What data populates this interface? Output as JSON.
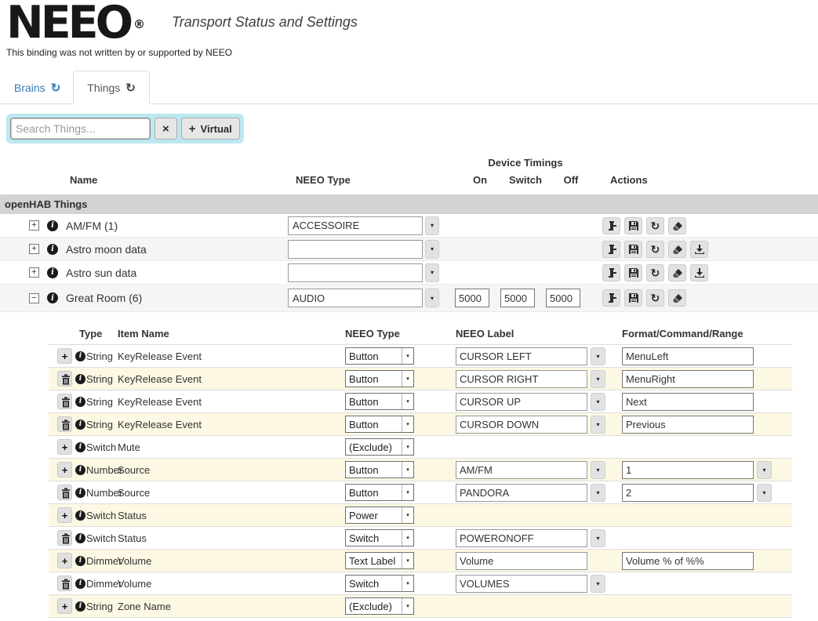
{
  "colors": {
    "accent_blue": "#337ab7",
    "search_bg": "#bce8f1",
    "row_warning_bg": "#fcf8e3",
    "row_striped_bg": "#f5f5f5",
    "group_header_bg": "#d3d3d3",
    "logo_black": "#181818"
  },
  "icons": {
    "caret": "▾",
    "refresh": "↻",
    "close": "×",
    "plus": "+",
    "expand": "+",
    "collapse": "−",
    "info": "i",
    "registered": "®"
  },
  "header": {
    "logo": "NEEO",
    "title": "Transport Status and Settings",
    "disclaimer": "This binding was not written by or supported by NEEO"
  },
  "tabs": {
    "brains": "Brains",
    "things": "Things"
  },
  "toolbar": {
    "search_placeholder": "Search Things...",
    "virtual_label": "Virtual"
  },
  "things": {
    "group_label": "openHAB Things",
    "headers": {
      "name": "Name",
      "neeo_type": "NEEO Type",
      "device_timings": "Device Timings",
      "on": "On",
      "switch": "Switch",
      "off": "Off",
      "actions": "Actions"
    },
    "rows": [
      {
        "name": "AM/FM (1)",
        "neeo_type": "ACCESSOIRE"
      },
      {
        "name": "Astro moon data",
        "neeo_type": ""
      },
      {
        "name": "Astro sun data",
        "neeo_type": ""
      },
      {
        "name": "Great Room (6)",
        "neeo_type": "AUDIO",
        "timing_on": "5000",
        "timing_switch": "5000",
        "timing_off": "5000"
      }
    ]
  },
  "channels": {
    "headers": {
      "type": "Type",
      "item_name": "Item Name",
      "neeo_type": "NEEO Type",
      "neeo_label": "NEEO Label",
      "format": "Format/Command/Range"
    },
    "rows": [
      {
        "type": "String",
        "item_name": "KeyRelease Event",
        "neeo_type": "Button",
        "neeo_label": "CURSOR LEFT",
        "format": "MenuLeft"
      },
      {
        "type": "String",
        "item_name": "KeyRelease Event",
        "neeo_type": "Button",
        "neeo_label": "CURSOR RIGHT",
        "format": "MenuRight"
      },
      {
        "type": "String",
        "item_name": "KeyRelease Event",
        "neeo_type": "Button",
        "neeo_label": "CURSOR UP",
        "format": "Next"
      },
      {
        "type": "String",
        "item_name": "KeyRelease Event",
        "neeo_type": "Button",
        "neeo_label": "CURSOR DOWN",
        "format": "Previous"
      },
      {
        "type": "Switch",
        "item_name": "Mute",
        "neeo_type": "(Exclude)"
      },
      {
        "type": "Number",
        "item_name": "Source",
        "neeo_type": "Button",
        "neeo_label": "AM/FM",
        "format": "1"
      },
      {
        "type": "Number",
        "item_name": "Source",
        "neeo_type": "Button",
        "neeo_label": "PANDORA",
        "format": "2"
      },
      {
        "type": "Switch",
        "item_name": "Status",
        "neeo_type": "Power"
      },
      {
        "type": "Switch",
        "item_name": "Status",
        "neeo_type": "Switch",
        "neeo_label": "POWERONOFF"
      },
      {
        "type": "Dimmer",
        "item_name": "Volume",
        "neeo_type": "Text Label",
        "neeo_label": "Volume",
        "format": "Volume % of %%"
      },
      {
        "type": "Dimmer",
        "item_name": "Volume",
        "neeo_type": "Switch",
        "neeo_label": "VOLUMES"
      },
      {
        "type": "String",
        "item_name": "Zone Name",
        "neeo_type": "(Exclude)"
      }
    ]
  }
}
